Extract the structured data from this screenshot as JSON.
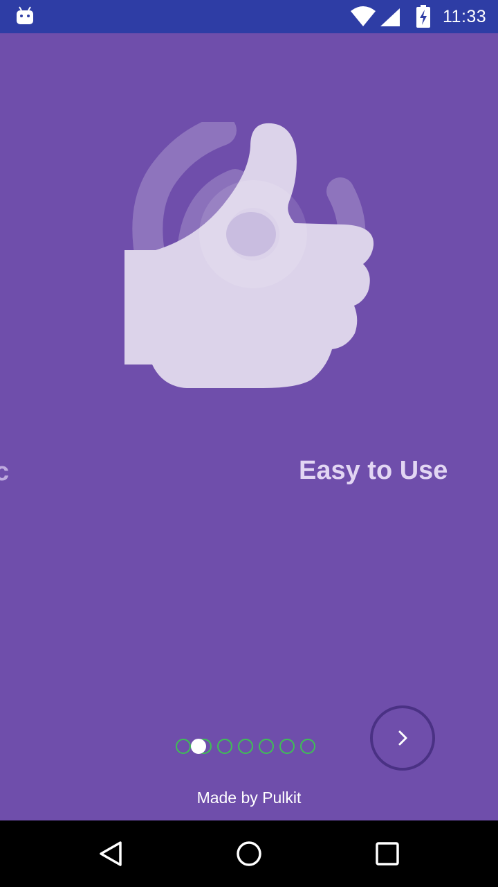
{
  "status_bar": {
    "time": "11:33",
    "icons": [
      "android-icon",
      "wifi-icon",
      "signal-icon",
      "battery-charging-icon"
    ]
  },
  "slides": {
    "previous_title": "c",
    "current_title": "Easy to Use"
  },
  "pager": {
    "dot_count": 7,
    "active_index": 1,
    "dot_color": "#3fbf55",
    "active_color": "#ffffff"
  },
  "next_button": {
    "icon": "chevron-right-icon"
  },
  "footer": {
    "credit": "Made by Pulkit"
  },
  "nav_bar": {
    "icons": [
      "back-icon",
      "home-icon",
      "recents-icon"
    ]
  },
  "colors": {
    "background": "#6f4eab",
    "status_bar": "#2e3da5",
    "title": "#e2d6f3"
  }
}
